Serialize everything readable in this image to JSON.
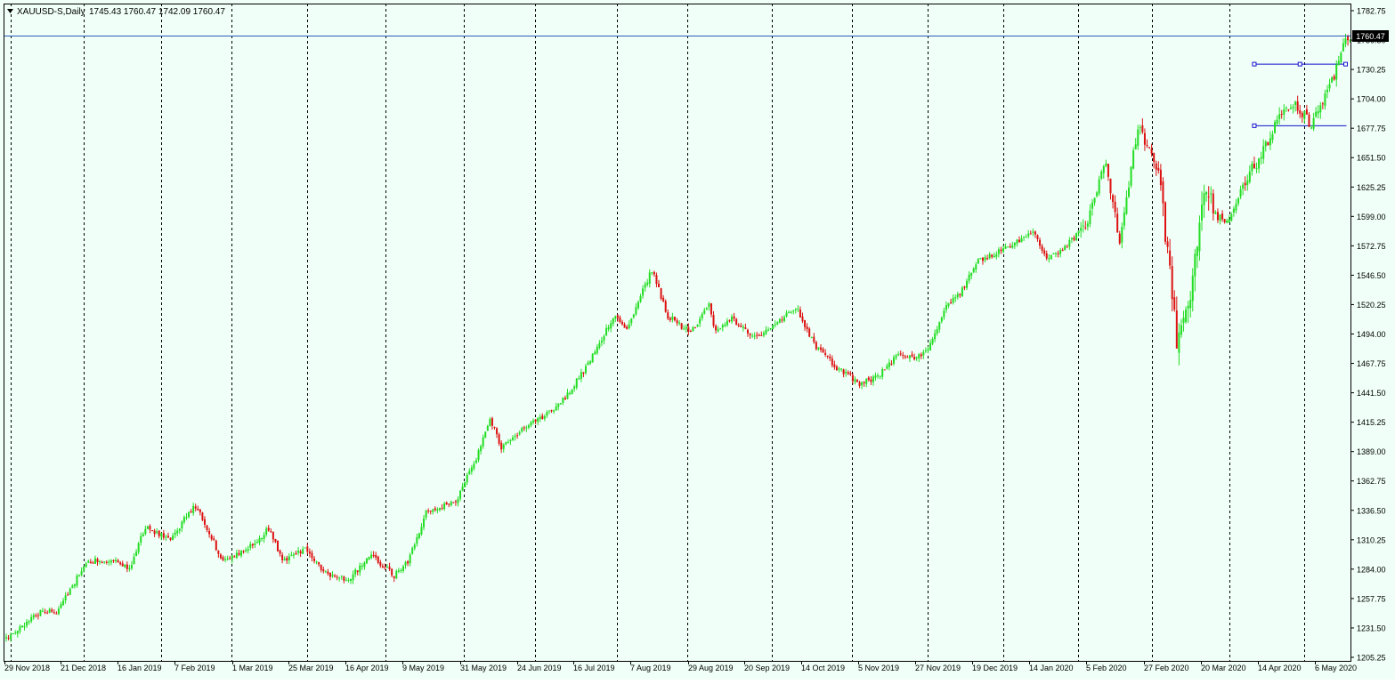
{
  "header": {
    "symbol": "XAUUSD-S,Daily",
    "ohlc": "1745.43 1760.47 1742.09 1760.47"
  },
  "price_marker": "1760.47",
  "colors": {
    "background": "#F0FFF8",
    "bull": "#22DD22",
    "bear": "#DD1111",
    "wick": "#333333",
    "grid": "#000000",
    "price_line": "#2E5CB8",
    "object": "#1111CC"
  },
  "chart_data": {
    "type": "candlestick",
    "title": "",
    "xlabel": "",
    "ylabel": "",
    "ylim": [
      1205.25,
      1782.75
    ],
    "y_ticks": [
      "1782.75",
      "1756.50",
      "1730.25",
      "1704.00",
      "1677.75",
      "1651.50",
      "1625.25",
      "1599.00",
      "1572.75",
      "1546.50",
      "1520.25",
      "1494.00",
      "1467.75",
      "1441.50",
      "1415.25",
      "1389.00",
      "1362.75",
      "1336.50",
      "1310.25",
      "1284.00",
      "1257.75",
      "1231.50",
      "1205.25"
    ],
    "x_ticks": [
      "29 Nov 2018",
      "21 Dec 2018",
      "16 Jan 2019",
      "7 Feb 2019",
      "1 Mar 2019",
      "25 Mar 2019",
      "16 Apr 2019",
      "9 May 2019",
      "31 May 2019",
      "24 Jun 2019",
      "16 Jul 2019",
      "7 Aug 2019",
      "29 Aug 2019",
      "20 Sep 2019",
      "14 Oct 2019",
      "5 Nov 2019",
      "27 Nov 2019",
      "19 Dec 2019",
      "14 Jan 2020",
      "5 Feb 2020",
      "27 Feb 2020",
      "20 Mar 2020",
      "14 Apr 2020",
      "6 May 2020"
    ],
    "anchors": [
      [
        0,
        1222
      ],
      [
        16,
        1247
      ],
      [
        22,
        1245
      ],
      [
        35,
        1290
      ],
      [
        45,
        1293
      ],
      [
        54,
        1285
      ],
      [
        61,
        1322
      ],
      [
        72,
        1310
      ],
      [
        82,
        1340
      ],
      [
        86,
        1330
      ],
      [
        95,
        1290
      ],
      [
        108,
        1306
      ],
      [
        115,
        1320
      ],
      [
        121,
        1292
      ],
      [
        131,
        1302
      ],
      [
        140,
        1280
      ],
      [
        150,
        1275
      ],
      [
        160,
        1296
      ],
      [
        170,
        1278
      ],
      [
        176,
        1290
      ],
      [
        184,
        1335
      ],
      [
        197,
        1345
      ],
      [
        206,
        1383
      ],
      [
        212,
        1418
      ],
      [
        217,
        1393
      ],
      [
        232,
        1418
      ],
      [
        240,
        1425
      ],
      [
        246,
        1440
      ],
      [
        256,
        1470
      ],
      [
        266,
        1510
      ],
      [
        272,
        1500
      ],
      [
        283,
        1551
      ],
      [
        290,
        1510
      ],
      [
        300,
        1495
      ],
      [
        308,
        1520
      ],
      [
        311,
        1495
      ],
      [
        318,
        1508
      ],
      [
        328,
        1490
      ],
      [
        340,
        1508
      ],
      [
        346,
        1518
      ],
      [
        355,
        1482
      ],
      [
        365,
        1462
      ],
      [
        374,
        1450
      ],
      [
        381,
        1455
      ],
      [
        391,
        1475
      ],
      [
        398,
        1473
      ],
      [
        404,
        1480
      ],
      [
        412,
        1520
      ],
      [
        418,
        1530
      ],
      [
        426,
        1560
      ],
      [
        440,
        1572
      ],
      [
        450,
        1585
      ],
      [
        456,
        1562
      ],
      [
        462,
        1568
      ],
      [
        473,
        1590
      ],
      [
        482,
        1648
      ],
      [
        488,
        1575
      ],
      [
        496,
        1680
      ],
      [
        505,
        1640
      ],
      [
        513,
        1490
      ],
      [
        518,
        1510
      ],
      [
        525,
        1620
      ],
      [
        534,
        1590
      ],
      [
        545,
        1640
      ],
      [
        548,
        1645
      ],
      [
        558,
        1688
      ],
      [
        565,
        1700
      ],
      [
        572,
        1680
      ],
      [
        582,
        1725
      ],
      [
        587,
        1760
      ]
    ],
    "boxes": [
      {
        "start": 547,
        "end": 587,
        "top": 1735,
        "bottom": 1680
      }
    ]
  }
}
